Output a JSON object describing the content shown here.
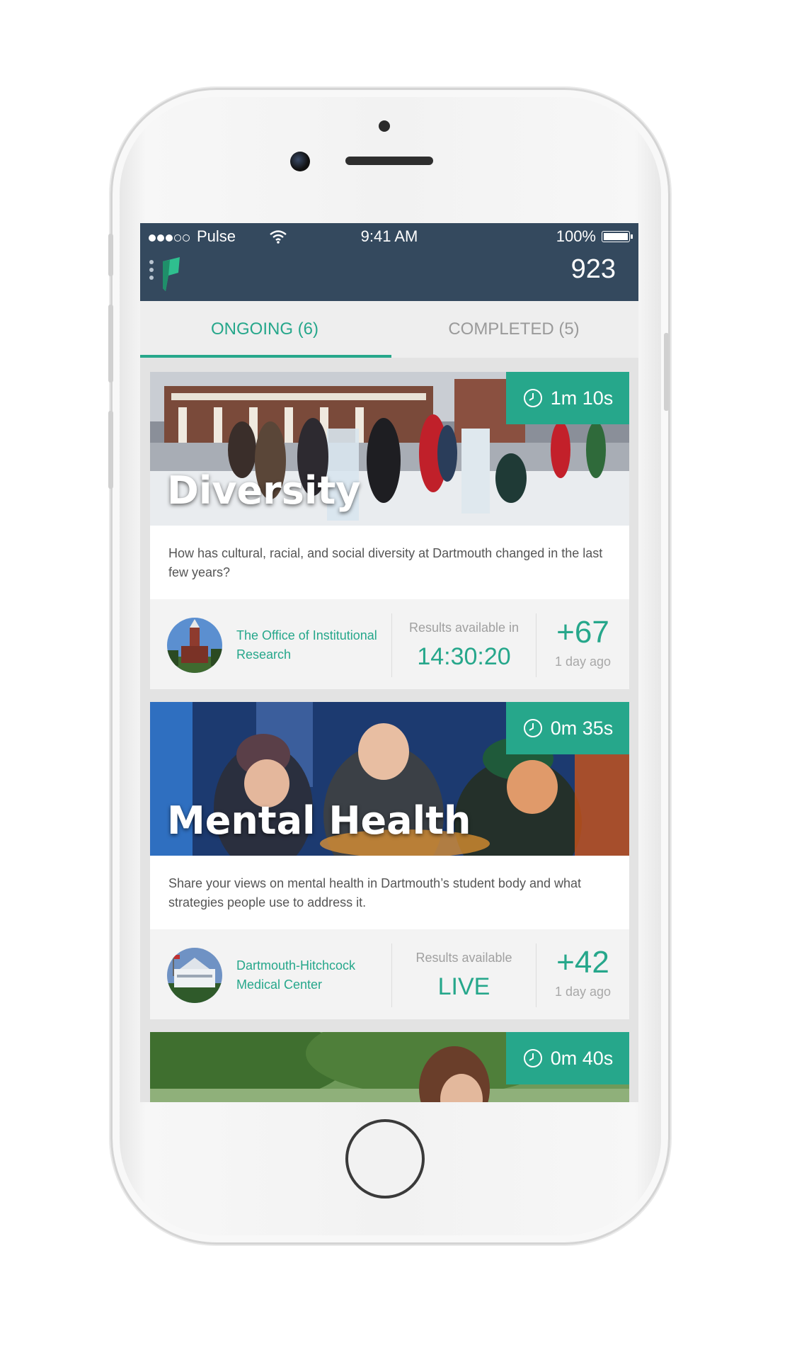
{
  "status_bar": {
    "carrier": "Pulse",
    "time": "9:41 AM",
    "battery": "100%"
  },
  "header": {
    "score": "923"
  },
  "tabs": [
    {
      "label": "ONGOING (6)",
      "active": true
    },
    {
      "label": "COMPLETED (5)",
      "active": false
    }
  ],
  "cards": [
    {
      "title": "Diversity",
      "timer": "1m 10s",
      "description": "How has cultural, racial, and social diversity at Dartmouth changed in the last few years?",
      "org": "The Office of Institutional Research",
      "results_label": "Results available in",
      "results_value": "14:30:20",
      "delta": "+67",
      "ago": "1 day ago"
    },
    {
      "title": "Mental Health",
      "timer": "0m 35s",
      "description": "Share your views on mental health in Dartmouth’s student body and what strategies people use to address it.",
      "org": "Dartmouth-Hitchcock Medical Center",
      "results_label": "Results available",
      "results_value": "LIVE",
      "delta": "+42",
      "ago": "1 day ago"
    },
    {
      "title": "",
      "timer": "0m 40s"
    }
  ],
  "colors": {
    "accent": "#26a78b",
    "header_bg": "#34495e"
  }
}
